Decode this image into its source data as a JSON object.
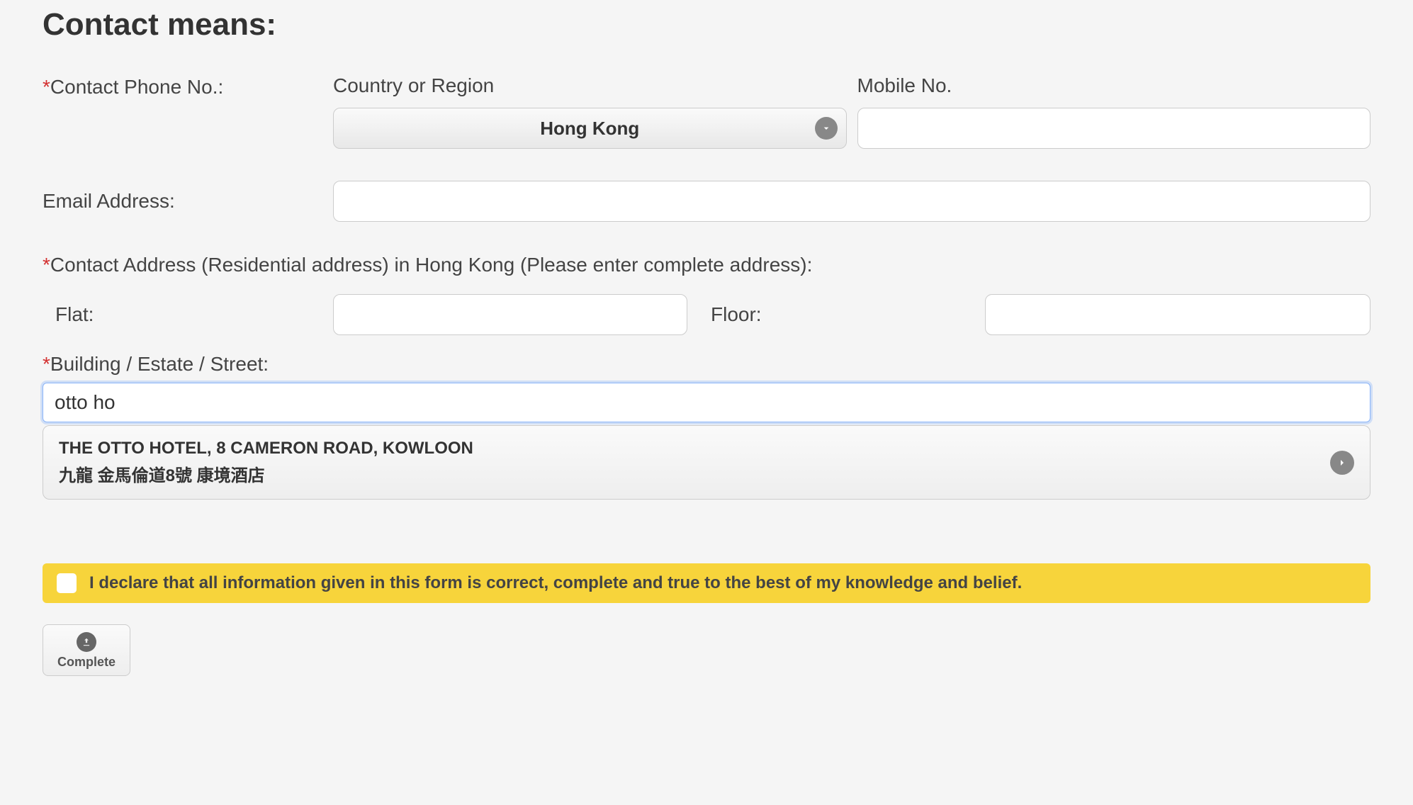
{
  "heading": "Contact means:",
  "contactPhone": {
    "label": "Contact Phone No.:",
    "countryLabel": "Country or Region",
    "countryValue": "Hong Kong",
    "mobileLabel": "Mobile No.",
    "mobileValue": ""
  },
  "email": {
    "label": "Email Address:",
    "value": ""
  },
  "address": {
    "heading": "Contact Address (Residential address) in Hong Kong (Please enter complete address):",
    "flatLabel": "Flat:",
    "flatValue": "",
    "floorLabel": "Floor:",
    "floorValue": "",
    "buildingLabel": "Building / Estate / Street:",
    "buildingValue": "otto ho",
    "suggestion": {
      "line1": "THE OTTO HOTEL, 8 CAMERON ROAD, KOWLOON",
      "line2": "九龍 金馬倫道8號 康境酒店"
    }
  },
  "declaration": {
    "text": "I declare that all information given in this form is correct, complete and true to the best of my knowledge and belief.",
    "checked": false
  },
  "completeButton": {
    "label": "Complete"
  }
}
